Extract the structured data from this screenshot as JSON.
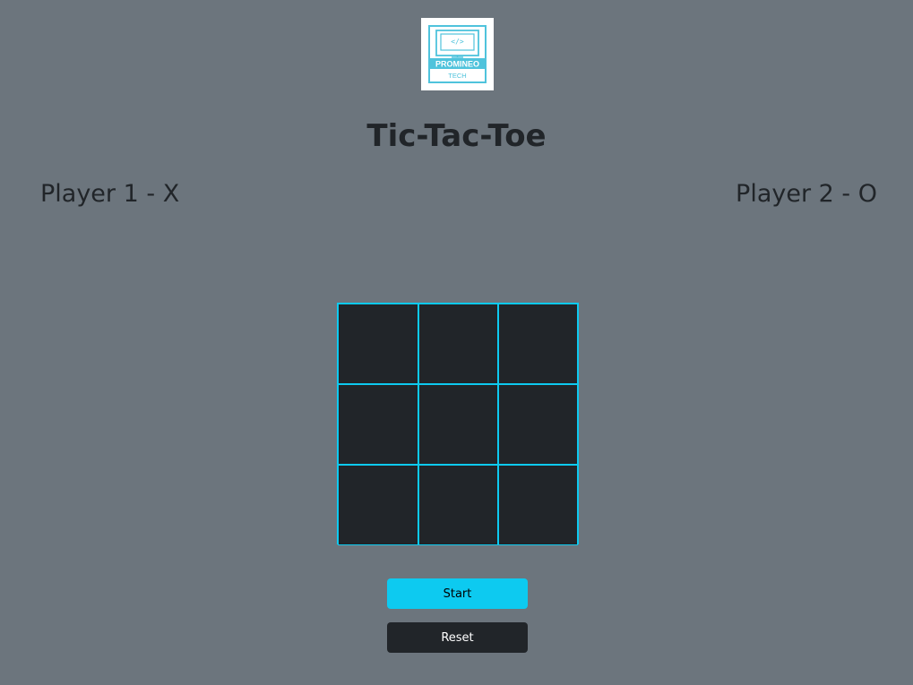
{
  "logo": {
    "line1": "PROMINEO",
    "line2": "TECH",
    "code_glyph": "</>"
  },
  "title": "Tic-Tac-Toe",
  "players": {
    "player1": "Player 1 - X",
    "player2": "Player 2 - O"
  },
  "board": {
    "cells": [
      "",
      "",
      "",
      "",
      "",
      "",
      "",
      "",
      ""
    ]
  },
  "buttons": {
    "start": "Start",
    "reset": "Reset"
  },
  "colors": {
    "background": "#6c757d",
    "board": "#212529",
    "grid_lines": "#0dcaf0",
    "start_button": "#0dcaf0",
    "reset_button": "#212529"
  }
}
